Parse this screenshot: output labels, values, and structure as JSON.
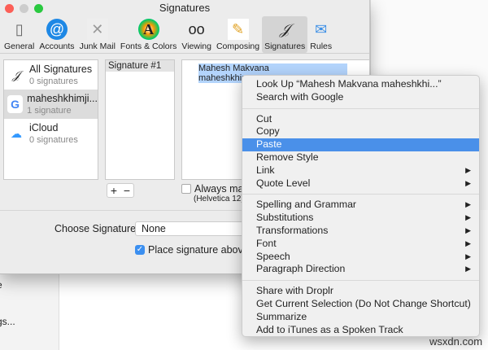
{
  "window": {
    "title": "Signatures"
  },
  "toolbar": [
    {
      "label": "General",
      "icon": "phone-icon"
    },
    {
      "label": "Accounts",
      "icon": "at-icon"
    },
    {
      "label": "Junk Mail",
      "icon": "trash-icon"
    },
    {
      "label": "Fonts & Colors",
      "icon": "font-icon"
    },
    {
      "label": "Viewing",
      "icon": "glasses-icon"
    },
    {
      "label": "Composing",
      "icon": "pencil-icon"
    },
    {
      "label": "Signatures",
      "icon": "signature-icon"
    },
    {
      "label": "Rules",
      "icon": "rules-icon"
    }
  ],
  "accounts": [
    {
      "name": "All Signatures",
      "count": "0 signatures"
    },
    {
      "name": "maheshkhimji...",
      "count": "1 signature"
    },
    {
      "name": "iCloud",
      "count": "0 signatures"
    }
  ],
  "signatures": [
    "Signature #1"
  ],
  "editor": {
    "line1": "Mahesh Makvana",
    "line2": "maheshkhim"
  },
  "buttons": {
    "add": "+",
    "remove": "−"
  },
  "always_match": {
    "label": "Always mate",
    "font": "(Helvetica 12)"
  },
  "choose": {
    "label": "Choose Signature:",
    "value": "None"
  },
  "place_above": {
    "label": "Place signature above q",
    "checked": true
  },
  "side_text": [
    "e",
    "gs..."
  ],
  "menu": {
    "groups": [
      [
        {
          "label": "Look Up “Mahesh Makvana maheshkhi...”"
        },
        {
          "label": "Search with Google"
        }
      ],
      [
        {
          "label": "Cut"
        },
        {
          "label": "Copy"
        },
        {
          "label": "Paste",
          "highlighted": true
        },
        {
          "label": "Remove Style"
        },
        {
          "label": "Link",
          "submenu": true
        },
        {
          "label": "Quote Level",
          "submenu": true
        }
      ],
      [
        {
          "label": "Spelling and Grammar",
          "submenu": true
        },
        {
          "label": "Substitutions",
          "submenu": true
        },
        {
          "label": "Transformations",
          "submenu": true
        },
        {
          "label": "Font",
          "submenu": true
        },
        {
          "label": "Speech",
          "submenu": true
        },
        {
          "label": "Paragraph Direction",
          "submenu": true
        }
      ],
      [
        {
          "label": "Share with Droplr"
        },
        {
          "label": "Get Current Selection (Do Not Change Shortcut)"
        },
        {
          "label": "Summarize"
        },
        {
          "label": "Add to iTunes as a Spoken Track"
        }
      ]
    ]
  },
  "watermark": "wsxdn.com",
  "colors": {
    "accent": "#4a90e9",
    "selection": "#b3d4fc"
  }
}
